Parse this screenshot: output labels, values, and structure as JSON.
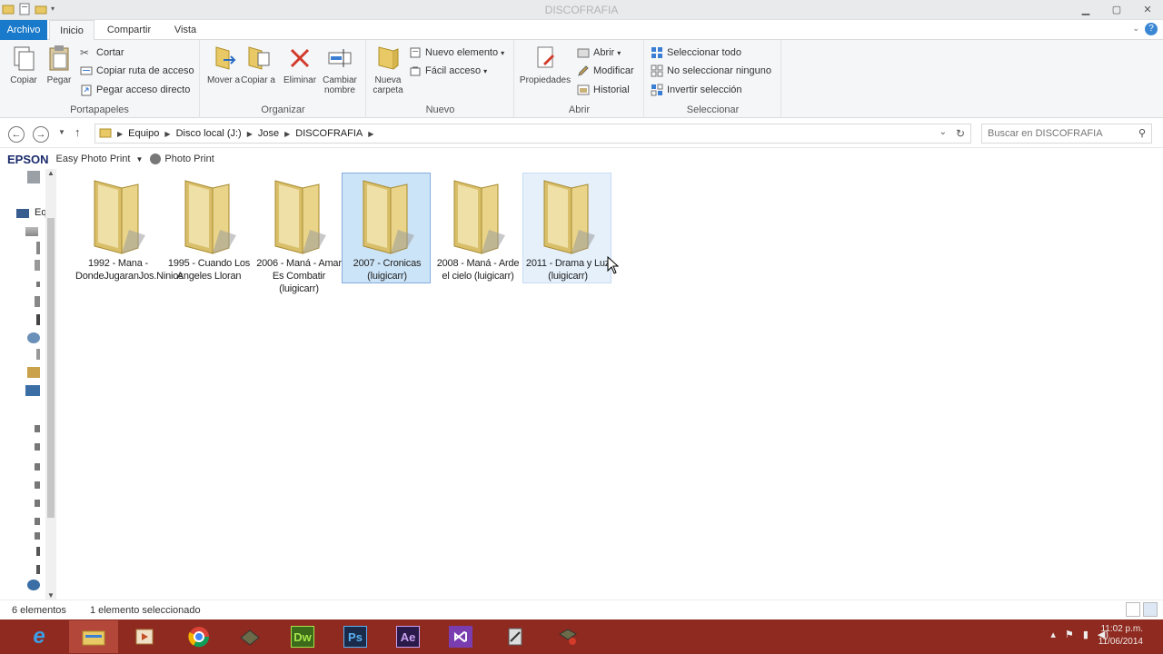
{
  "window": {
    "title": "DISCOFRAFIA"
  },
  "tabs": {
    "file": "Archivo",
    "home": "Inicio",
    "share": "Compartir",
    "view": "Vista"
  },
  "ribbon": {
    "portapapeles": {
      "label": "Portapapeles",
      "copy": "Copiar",
      "paste": "Pegar",
      "cut": "Cortar",
      "copy_path": "Copiar ruta de acceso",
      "paste_shortcut": "Pegar acceso directo"
    },
    "organizar": {
      "label": "Organizar",
      "move_to": "Mover a",
      "copy_to": "Copiar a",
      "delete": "Eliminar",
      "rename": "Cambiar nombre"
    },
    "nuevo": {
      "label": "Nuevo",
      "new_folder": "Nueva carpeta",
      "new_item": "Nuevo elemento",
      "easy_access": "Fácil acceso"
    },
    "abrir": {
      "label": "Abrir",
      "properties": "Propiedades",
      "open": "Abrir",
      "edit": "Modificar",
      "history": "Historial"
    },
    "seleccionar": {
      "label": "Seleccionar",
      "select_all": "Seleccionar todo",
      "select_none": "No seleccionar ninguno",
      "invert": "Invertir selección"
    }
  },
  "address": {
    "crumbs": [
      "Equipo",
      "Disco local (J:)",
      "Jose",
      "DISCOFRAFIA"
    ]
  },
  "search": {
    "placeholder": "Buscar en DISCOFRAFIA"
  },
  "epson": {
    "logo": "EPSON",
    "easy_photo_print": "Easy Photo Print",
    "photo_print": "Photo Print"
  },
  "folders": [
    {
      "name": "1992 -  Mana - DondeJugaranJos.Ninios",
      "state": "normal"
    },
    {
      "name": "1995 - Cuando Los Angeles Lloran",
      "state": "normal"
    },
    {
      "name": "2006 -  Maná - Amar Es Combatir (luigicarr)",
      "state": "normal"
    },
    {
      "name": "2007 - Cronicas (luigicarr)",
      "state": "selected"
    },
    {
      "name": "2008 -  Maná - Arde el cielo (luigicarr)",
      "state": "normal"
    },
    {
      "name": "2011 - Drama y Luz (luigicarr)",
      "state": "hover"
    }
  ],
  "status": {
    "count": "6 elementos",
    "selected": "1 elemento seleccionado"
  },
  "taskbar": {
    "apps": [
      "Internet Explorer",
      "Explorador de archivos",
      "Media",
      "Chrome",
      "App",
      "Dw",
      "Ps",
      "Ae",
      "Visual Studio",
      "App",
      "App"
    ],
    "dw": "Dw",
    "ps": "Ps",
    "ae": "Ae"
  },
  "clock": {
    "time": "11:02 p.m.",
    "date": "11/06/2014"
  },
  "nav": {
    "partial_label": "Eq"
  }
}
